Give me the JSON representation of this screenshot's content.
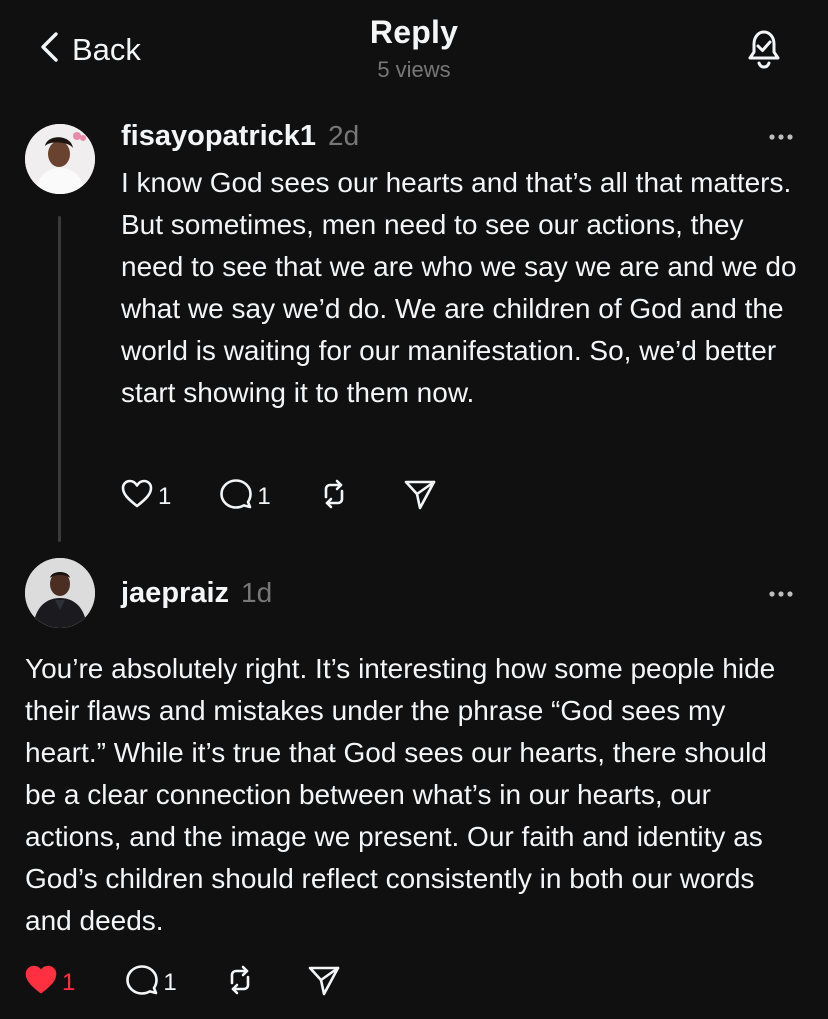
{
  "header": {
    "back_label": "Back",
    "title": "Reply",
    "views": "5 views"
  },
  "posts": [
    {
      "username": "fisayopatrick1",
      "time": "2d",
      "text": "I know God sees our hearts and that’s all that matters. But sometimes, men need to see our actions, they need to see that we are who we say we are and we do what we say we’d do. We are children of God and the world is waiting for our manifestation. So, we’d better start showing it to them now.",
      "likes": "1",
      "replies": "1",
      "liked": false
    },
    {
      "username": "jaepraiz",
      "time": "1d",
      "text": "You’re absolutely right. It’s interesting how some people hide their flaws and mistakes under the phrase “God sees my heart.” While it’s true that God sees our hearts, there should be a clear connection between what’s in our hearts, our actions, and the image we present. Our faith and identity as God’s children should reflect consistently in both our words and deeds.",
      "likes": "1",
      "replies": "1",
      "liked": true
    }
  ],
  "colors": {
    "background": "#101010",
    "text": "#f3f5f7",
    "muted": "#777777",
    "like_red": "#ff3040"
  },
  "icons": [
    "chevron-left-icon",
    "bell-check-icon",
    "more-icon",
    "heart-icon",
    "comment-icon",
    "repost-icon",
    "share-icon"
  ]
}
